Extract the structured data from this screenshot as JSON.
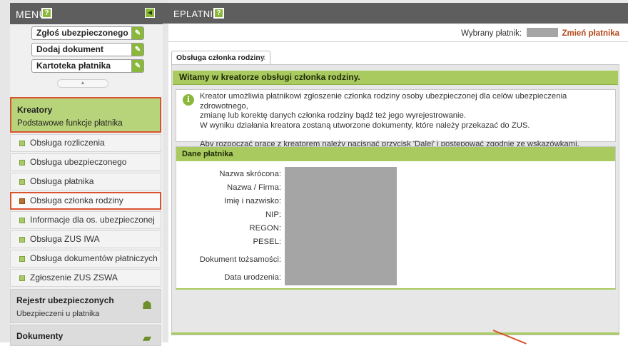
{
  "sidebar": {
    "menu_title": "MENU",
    "help_label": "?",
    "collapse_label": "◀",
    "quick_actions": [
      {
        "label": "Zgłoś ubezpieczonego"
      },
      {
        "label": "Dodaj dokument"
      },
      {
        "label": "Kartoteka płatnika"
      }
    ],
    "scroll_label": "▲",
    "kreatory": {
      "title": "Kreatory",
      "subtitle": "Podstawowe funkcje płatnika"
    },
    "items": [
      {
        "label": "Obsługa rozliczenia"
      },
      {
        "label": "Obsługa ubezpieczonego"
      },
      {
        "label": "Obsługa płatnika"
      },
      {
        "label": "Obsługa członka rodziny"
      },
      {
        "label": "Informacje dla os. ubezpieczonej"
      },
      {
        "label": "Obsługa ZUS IWA"
      },
      {
        "label": "Obsługa dokumentów płatniczych"
      },
      {
        "label": "Zgłoszenie ZUS ZSWA"
      }
    ],
    "sections": [
      {
        "title": "Rejestr ubezpieczonych",
        "subtitle": "Ubezpieczeni u płatnika",
        "icon": "people-icon"
      },
      {
        "title": "Dokumenty",
        "subtitle": "",
        "icon": "folder-icon"
      }
    ]
  },
  "header": {
    "title": "EPLATNIK",
    "help_label": "?"
  },
  "platnik": {
    "label": "Wybrany płatnik:",
    "change_link": "Zmień płatnika"
  },
  "tab": {
    "label": "Obsługa członka rodziny",
    "close": "x"
  },
  "wizard": {
    "welcome": "Witamy w kreatorze obsługi członka rodziny.",
    "info_icon": "i",
    "info_lines": [
      "Kreator umożliwia płatnikowi zgłoszenie członka rodziny osoby ubezpieczonej dla celów ubezpieczenia zdrowotnego,",
      "zmianę lub korektę danych członka rodziny bądź też jego wyrejestrowanie.",
      "W wyniku działania kreatora zostaną utworzone dokumenty, które należy przekazać do ZUS.",
      "Aby rozpocząć pracę z kreatorem należy nacisnąć przycisk 'Dalej' i postępować zgodnie ze wskazówkami."
    ]
  },
  "dane": {
    "title": "Dane płatnika",
    "fields": [
      {
        "label": "Nazwa skrócona:"
      },
      {
        "label": "Nazwa / Firma:"
      },
      {
        "label": "Imię i nazwisko:"
      },
      {
        "label": "NIP:"
      },
      {
        "label": "REGON:"
      },
      {
        "label": "PESEL:"
      },
      {
        "label": "Dokument tożsamości:"
      },
      {
        "label": "Data urodzenia:"
      }
    ]
  },
  "colors": {
    "accent_green": "#a9ca5e",
    "highlight_red": "#d9532e",
    "header_gray": "#5e5e5e",
    "link_orange": "#b5471b"
  }
}
